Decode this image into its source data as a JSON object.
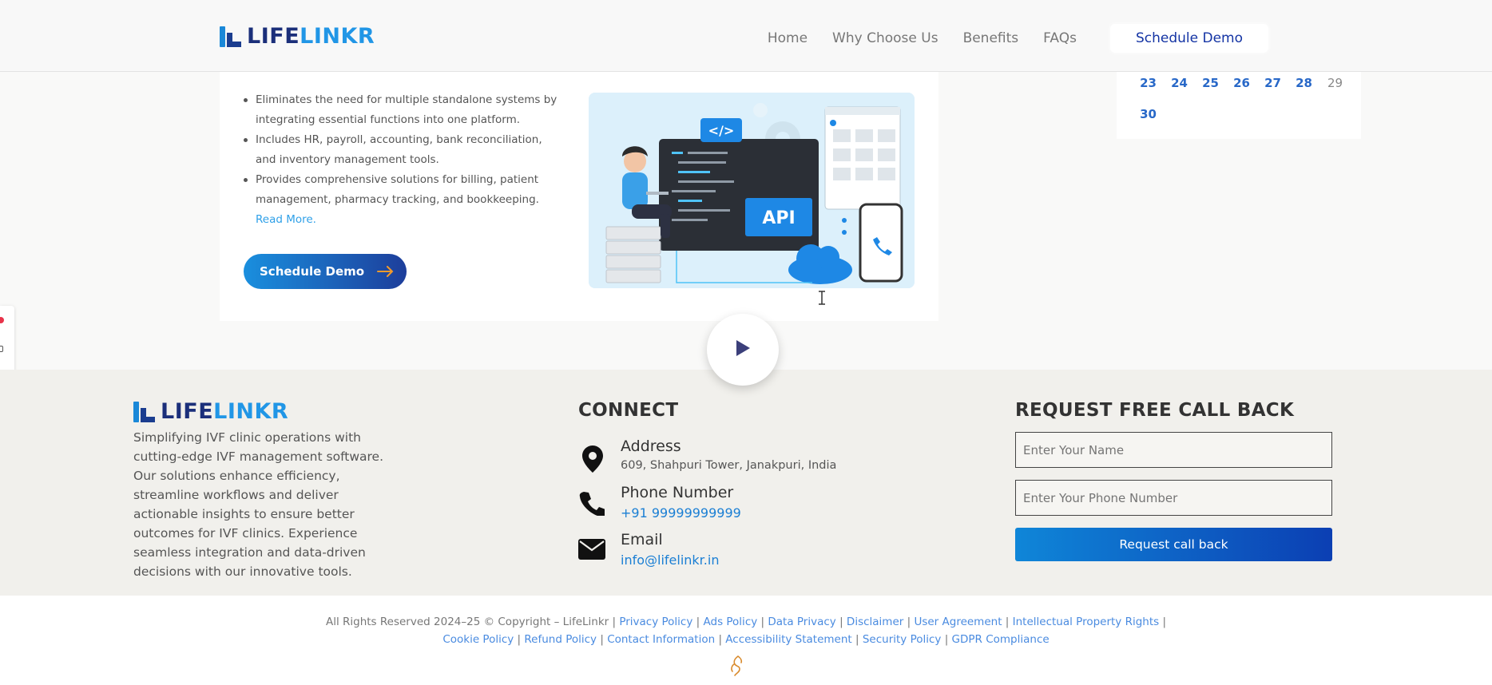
{
  "brand": {
    "life": "LIFE",
    "linkr": "LINKR"
  },
  "nav": {
    "items": [
      "Home",
      "Why Choose Us",
      "Benefits",
      "FAQs"
    ],
    "cta": "Schedule Demo"
  },
  "calendar": {
    "row1": [
      "23",
      "24",
      "25",
      "26",
      "27",
      "28",
      "29"
    ],
    "row2": [
      "30"
    ]
  },
  "feature": {
    "bullets": [
      "Eliminates the need for multiple standalone systems by integrating essential functions into one platform.",
      "Includes HR, payroll, accounting, bank reconciliation, and inventory management tools.",
      "Provides comprehensive solutions for billing, patient management, pharmacy tracking, and bookkeeping."
    ],
    "read_more": "Read More.",
    "cta": "Schedule Demo",
    "illustration": {
      "code_tag": "</>",
      "api_label": "API"
    }
  },
  "footer": {
    "about": "Simplifying IVF clinic operations with cutting-edge IVF management software. Our solutions enhance efficiency, streamline workflows and deliver actionable insights to ensure better outcomes for IVF clinics. Experience seamless integration and data-driven decisions with our innovative tools.",
    "connect": {
      "title": "CONNECT",
      "address_label": "Address",
      "address_value": "609, Shahpuri Tower, Janakpuri, India",
      "phone_label": "Phone Number",
      "phone_value": "+91 99999999999",
      "email_label": "Email",
      "email_value": "info@lifelinkr.in"
    },
    "callback": {
      "title": "REQUEST FREE CALL BACK",
      "name_placeholder": "Enter Your Name",
      "phone_placeholder": "Enter Your Phone Number",
      "button": "Request call back"
    }
  },
  "copyright": {
    "text": "All Rights Reserved 2024–25 © Copyright – LifeLinkr |",
    "links_line1": [
      "Privacy Policy",
      "Ads Policy",
      "Data Privacy",
      "Disclaimer",
      "User Agreement",
      "Intellectual Property Rights"
    ],
    "links_line2": [
      "Cookie Policy",
      "Refund Policy",
      "Contact Information",
      "Accessibility Statement",
      "Security Policy",
      "GDPR Compliance"
    ]
  },
  "icons": {
    "play": "play-icon",
    "address": "map-pin-icon",
    "phone": "phone-icon",
    "email": "envelope-icon",
    "arrow": "arrow-right-icon",
    "text_cursor": "i-beam-cursor-icon"
  },
  "colors": {
    "brand_dark": "#1b2f7a",
    "brand_light": "#2196e6",
    "cta_gradient_start": "#1a8fde",
    "cta_gradient_end": "#1d3e9b",
    "link": "#1b7fd4",
    "accent_orange": "#f39a2b"
  }
}
